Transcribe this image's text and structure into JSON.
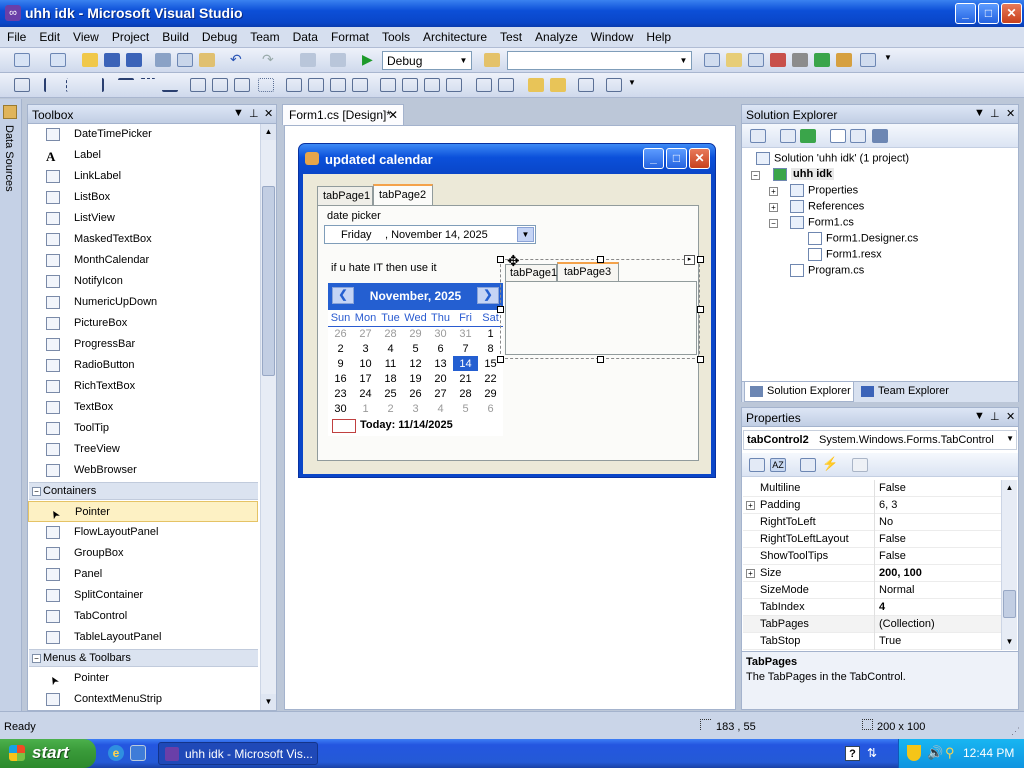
{
  "window": {
    "title": "uhh idk - Microsoft Visual Studio",
    "min": "_",
    "max": "□",
    "close": "✕"
  },
  "menu": [
    "File",
    "Edit",
    "View",
    "Project",
    "Build",
    "Debug",
    "Team",
    "Data",
    "Format",
    "Tools",
    "Architecture",
    "Test",
    "Analyze",
    "Window",
    "Help"
  ],
  "toolbar": {
    "config": "Debug",
    "search": ""
  },
  "sidestrip": {
    "label": "Data Sources"
  },
  "toolbox": {
    "title": "Toolbox",
    "items_top": [
      "DateTimePicker",
      "Label",
      "LinkLabel",
      "ListBox",
      "ListView",
      "MaskedTextBox",
      "MonthCalendar",
      "NotifyIcon",
      "NumericUpDown",
      "PictureBox",
      "ProgressBar",
      "RadioButton",
      "RichTextBox",
      "TextBox",
      "ToolTip",
      "TreeView",
      "WebBrowser"
    ],
    "group_containers": "Containers",
    "items_containers": [
      "Pointer",
      "FlowLayoutPanel",
      "GroupBox",
      "Panel",
      "SplitContainer",
      "TabControl",
      "TableLayoutPanel"
    ],
    "group_menus": "Menus & Toolbars",
    "items_menus": [
      "Pointer",
      "ContextMenuStrip"
    ]
  },
  "doc": {
    "tab": "Form1.cs [Design]*",
    "close": "✕"
  },
  "form": {
    "title": "updated calendar",
    "tab1": "tabPage1",
    "tab2": "tabPage2",
    "date_label": "date picker",
    "picker_day": "Friday",
    "picker_date": ", November 14, 2025",
    "hate_label": "if u hate IT then use it",
    "inner_tab1": "tabPage1",
    "inner_tab3": "tabPage3",
    "calendar": {
      "month": "November, 2025",
      "days": [
        "Sun",
        "Mon",
        "Tue",
        "Wed",
        "Thu",
        "Fri",
        "Sat"
      ],
      "weeks": [
        [
          "26",
          "27",
          "28",
          "29",
          "30",
          "31",
          "1"
        ],
        [
          "2",
          "3",
          "4",
          "5",
          "6",
          "7",
          "8"
        ],
        [
          "9",
          "10",
          "11",
          "12",
          "13",
          "14",
          "15"
        ],
        [
          "16",
          "17",
          "18",
          "19",
          "20",
          "21",
          "22"
        ],
        [
          "23",
          "24",
          "25",
          "26",
          "27",
          "28",
          "29"
        ],
        [
          "30",
          "1",
          "2",
          "3",
          "4",
          "5",
          "6"
        ]
      ],
      "today": "Today: 11/14/2025"
    }
  },
  "solution": {
    "title": "Solution Explorer",
    "root": "Solution 'uhh idk' (1 project)",
    "project": "uhh idk",
    "items": [
      "Properties",
      "References",
      "Form1.cs",
      "Form1.Designer.cs",
      "Form1.resx",
      "Program.cs"
    ],
    "tab_sol": "Solution Explorer",
    "tab_team": "Team Explorer"
  },
  "properties": {
    "title": "Properties",
    "object": "tabControl2",
    "object_type": "System.Windows.Forms.TabControl",
    "rows": [
      {
        "name": "Multiline",
        "value": "False"
      },
      {
        "name": "Padding",
        "value": "6, 3"
      },
      {
        "name": "RightToLeft",
        "value": "No"
      },
      {
        "name": "RightToLeftLayout",
        "value": "False"
      },
      {
        "name": "ShowToolTips",
        "value": "False"
      },
      {
        "name": "Size",
        "value": "200, 100"
      },
      {
        "name": "SizeMode",
        "value": "Normal"
      },
      {
        "name": "TabIndex",
        "value": "4"
      },
      {
        "name": "TabPages",
        "value": "(Collection)"
      },
      {
        "name": "TabStop",
        "value": "True"
      }
    ],
    "desc_title": "TabPages",
    "desc_text": "The TabPages in the TabControl."
  },
  "status": {
    "text": "Ready",
    "position": "183 , 55",
    "size": "200 x 100"
  },
  "taskbar": {
    "start": "start",
    "task": "uhh idk - Microsoft Vis...",
    "clock": "12:44 PM"
  }
}
